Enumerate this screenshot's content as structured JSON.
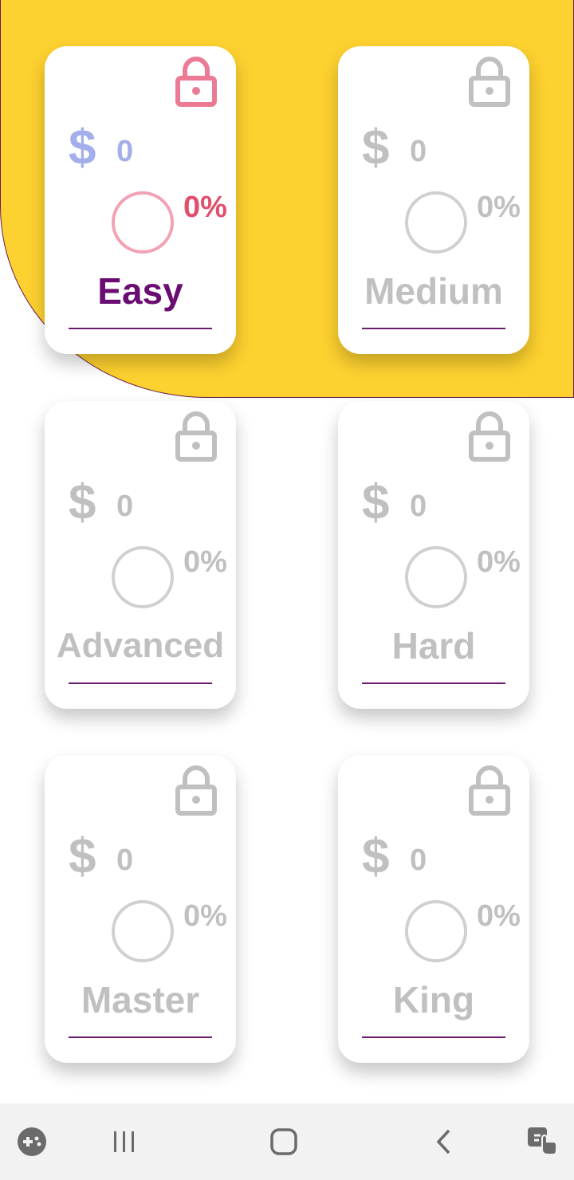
{
  "colors": {
    "background_accent": "#FDD12F",
    "card_bg": "#FFFFFF",
    "locked_gray": "#C0C0C0",
    "active_lock": "#EC7A94",
    "active_dollar": "#A4AEEA",
    "active_ring": "#F2A2B4",
    "active_percent": "#E0506E",
    "active_title": "#6A0C72",
    "underline": "#6A1B6E"
  },
  "levels": [
    {
      "name": "Easy",
      "amount": "0",
      "percent": "0%",
      "currency": "$",
      "progress": 0,
      "active": true,
      "lock_icon": "lock-icon"
    },
    {
      "name": "Medium",
      "amount": "0",
      "percent": "0%",
      "currency": "$",
      "progress": 0,
      "active": false,
      "lock_icon": "lock-icon"
    },
    {
      "name": "Advanced",
      "amount": "0",
      "percent": "0%",
      "currency": "$",
      "progress": 0,
      "active": false,
      "lock_icon": "lock-icon"
    },
    {
      "name": "Hard",
      "amount": "0",
      "percent": "0%",
      "currency": "$",
      "progress": 0,
      "active": false,
      "lock_icon": "lock-icon"
    },
    {
      "name": "Master",
      "amount": "0",
      "percent": "0%",
      "currency": "$",
      "progress": 0,
      "active": false,
      "lock_icon": "lock-icon"
    },
    {
      "name": "King",
      "amount": "0",
      "percent": "0%",
      "currency": "$",
      "progress": 0,
      "active": false,
      "lock_icon": "lock-icon"
    }
  ],
  "navbar": {
    "items": [
      "game-launcher-icon",
      "recent-apps-icon",
      "home-icon",
      "back-icon",
      "accessibility-touch-icon"
    ]
  }
}
